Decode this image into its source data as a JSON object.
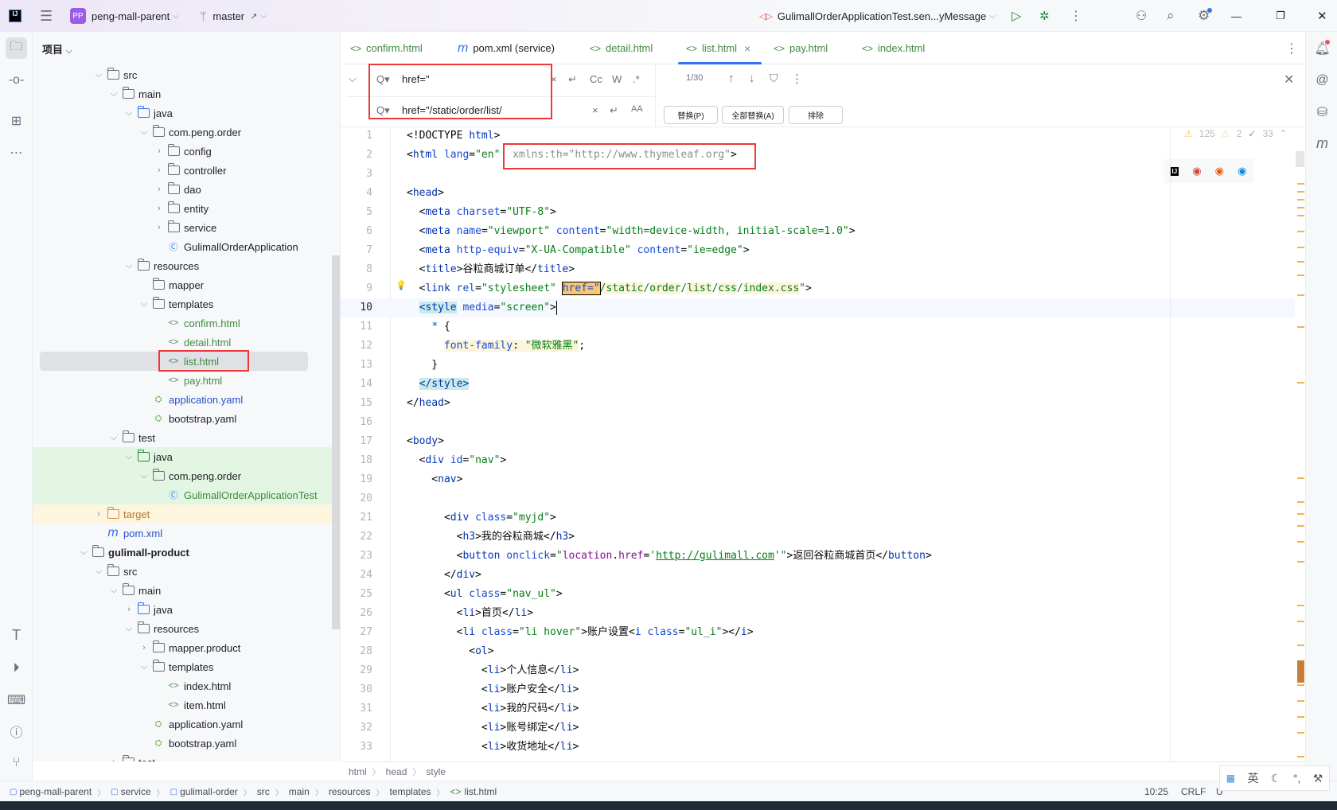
{
  "titlebar": {
    "project_badge": "PP",
    "project": "peng-mall-parent",
    "branch": "master",
    "run_config": "GulimallOrderApplicationTest.sen...yMessage"
  },
  "project_panel": {
    "title": "项目",
    "rows": [
      {
        "label": "src",
        "level": 2,
        "chev": "open",
        "icon": "folder"
      },
      {
        "label": "main",
        "level": 3,
        "chev": "open",
        "icon": "folder"
      },
      {
        "label": "java",
        "level": 4,
        "chev": "open",
        "icon": "folder-blue"
      },
      {
        "label": "com.peng.order",
        "level": 5,
        "chev": "open",
        "icon": "package"
      },
      {
        "label": "config",
        "level": 6,
        "chev": "closed",
        "icon": "package"
      },
      {
        "label": "controller",
        "level": 6,
        "chev": "closed",
        "icon": "package"
      },
      {
        "label": "dao",
        "level": 6,
        "chev": "closed",
        "icon": "package"
      },
      {
        "label": "entity",
        "level": 6,
        "chev": "closed",
        "icon": "package"
      },
      {
        "label": "service",
        "level": 6,
        "chev": "closed",
        "icon": "package"
      },
      {
        "label": "GulimallOrderApplication",
        "level": 6,
        "chev": "none",
        "icon": "spring-class"
      },
      {
        "label": "resources",
        "level": 4,
        "chev": "open",
        "icon": "folder-resources"
      },
      {
        "label": "mapper",
        "level": 5,
        "chev": "none",
        "icon": "folder"
      },
      {
        "label": "templates",
        "level": 5,
        "chev": "open",
        "icon": "folder"
      },
      {
        "label": "confirm.html",
        "level": 6,
        "chev": "none",
        "icon": "html",
        "color": "#3f8a3f"
      },
      {
        "label": "detail.html",
        "level": 6,
        "chev": "none",
        "icon": "html",
        "color": "#3f8a3f"
      },
      {
        "label": "list.html",
        "level": 6,
        "chev": "none",
        "icon": "html",
        "color": "#3f8a3f",
        "selected": true
      },
      {
        "label": "pay.html",
        "level": 6,
        "chev": "none",
        "icon": "html",
        "color": "#3f8a3f"
      },
      {
        "label": "application.yaml",
        "level": 5,
        "chev": "none",
        "icon": "spring-yaml",
        "color": "#2850c8"
      },
      {
        "label": "bootstrap.yaml",
        "level": 5,
        "chev": "none",
        "icon": "spring-yaml"
      },
      {
        "label": "test",
        "level": 3,
        "chev": "open",
        "icon": "folder"
      },
      {
        "label": "java",
        "level": 4,
        "chev": "open",
        "icon": "folder-green",
        "bg": "#e3f6e3"
      },
      {
        "label": "com.peng.order",
        "level": 5,
        "chev": "open",
        "icon": "package",
        "bg": "#e3f6e3"
      },
      {
        "label": "GulimallOrderApplicationTest",
        "level": 6,
        "chev": "none",
        "icon": "test-class",
        "color": "#3f8a3f",
        "bg": "#e3f6e3"
      },
      {
        "label": "target",
        "level": 2,
        "chev": "closed",
        "icon": "folder-orange",
        "color": "#b07a2a",
        "bg": "#fdf5dd"
      },
      {
        "label": "pom.xml",
        "level": 2,
        "chev": "none",
        "icon": "maven",
        "color": "#2850c8"
      },
      {
        "label": "gulimall-product",
        "level": 1,
        "chev": "open",
        "icon": "module",
        "bold": true
      },
      {
        "label": "src",
        "level": 2,
        "chev": "open",
        "icon": "folder"
      },
      {
        "label": "main",
        "level": 3,
        "chev": "open",
        "icon": "folder"
      },
      {
        "label": "java",
        "level": 4,
        "chev": "closed",
        "icon": "folder-blue"
      },
      {
        "label": "resources",
        "level": 4,
        "chev": "open",
        "icon": "folder-resources"
      },
      {
        "label": "mapper.product",
        "level": 5,
        "chev": "closed",
        "icon": "folder"
      },
      {
        "label": "templates",
        "level": 5,
        "chev": "open",
        "icon": "folder"
      },
      {
        "label": "index.html",
        "level": 6,
        "chev": "none",
        "icon": "html"
      },
      {
        "label": "item.html",
        "level": 6,
        "chev": "none",
        "icon": "html"
      },
      {
        "label": "application.yaml",
        "level": 5,
        "chev": "none",
        "icon": "spring-yaml"
      },
      {
        "label": "bootstrap.yaml",
        "level": 5,
        "chev": "none",
        "icon": "spring-yaml"
      },
      {
        "label": "test",
        "level": 3,
        "chev": "closed",
        "icon": "folder"
      }
    ]
  },
  "tabs": [
    {
      "label": "confirm.html",
      "icon": "html"
    },
    {
      "label": "pom.xml (service)",
      "icon": "maven"
    },
    {
      "label": "detail.html",
      "icon": "html"
    },
    {
      "label": "list.html",
      "icon": "html",
      "active": true
    },
    {
      "label": "pay.html",
      "icon": "html"
    },
    {
      "label": "index.html",
      "icon": "html"
    }
  ],
  "find": {
    "search_value": "href=\"",
    "replace_value": "href=\"/static/order/list/",
    "match_count": "1/30",
    "case_label": "Cc",
    "word_label": "W",
    "regex_label": ".*",
    "preserve_case_label": "AA",
    "replace_btn": "替换(P)",
    "replace_all_btn": "全部替换(A)",
    "exclude_btn": "排除"
  },
  "inspections": {
    "warnings": "125",
    "weak_warnings": "2",
    "typos": "33"
  },
  "editor": {
    "current_line": 10,
    "lines": [
      [
        [
          "p",
          "<!DOCTYPE "
        ],
        [
          "t",
          "html"
        ],
        [
          "p",
          ">"
        ]
      ],
      [
        [
          "p",
          "<"
        ],
        [
          "t",
          "html"
        ],
        [
          "a",
          " lang"
        ],
        [
          "p",
          "="
        ],
        [
          "v",
          "\"en\""
        ],
        [
          "g",
          "  xmlns:th=\"http://www.thymeleaf.org\""
        ],
        [
          "p",
          ">"
        ]
      ],
      [],
      [
        [
          "p",
          "<"
        ],
        [
          "t",
          "head"
        ],
        [
          "p",
          ">"
        ]
      ],
      [
        [
          "p",
          "  <"
        ],
        [
          "t",
          "meta"
        ],
        [
          "a",
          " charset"
        ],
        [
          "p",
          "="
        ],
        [
          "v",
          "\"UTF-8\""
        ],
        [
          "p",
          ">"
        ]
      ],
      [
        [
          "p",
          "  <"
        ],
        [
          "t",
          "meta"
        ],
        [
          "a",
          " name"
        ],
        [
          "p",
          "="
        ],
        [
          "v",
          "\"viewport\""
        ],
        [
          "a",
          " content"
        ],
        [
          "p",
          "="
        ],
        [
          "v",
          "\"width=device-width, initial-scale=1.0\""
        ],
        [
          "p",
          ">"
        ]
      ],
      [
        [
          "p",
          "  <"
        ],
        [
          "t",
          "meta"
        ],
        [
          "a",
          " http-equiv"
        ],
        [
          "p",
          "="
        ],
        [
          "v",
          "\"X-UA-Compatible\""
        ],
        [
          "a",
          " content"
        ],
        [
          "p",
          "="
        ],
        [
          "v",
          "\"ie=edge\""
        ],
        [
          "p",
          ">"
        ]
      ],
      [
        [
          "p",
          "  <"
        ],
        [
          "t",
          "title"
        ],
        [
          "p",
          ">谷粒商城订单</"
        ],
        [
          "t",
          "title"
        ],
        [
          "p",
          ">"
        ]
      ],
      [
        [
          "p",
          "  <"
        ],
        [
          "t",
          "link"
        ],
        [
          "a",
          " rel"
        ],
        [
          "p",
          "="
        ],
        [
          "v",
          "\"stylesheet\""
        ],
        [
          "p",
          " "
        ],
        [
          "hit",
          "href=\""
        ],
        [
          "vy",
          "/static"
        ],
        [
          "v",
          "/"
        ],
        [
          "vy",
          "order"
        ],
        [
          "v",
          "/"
        ],
        [
          "vy",
          "list"
        ],
        [
          "v",
          "/"
        ],
        [
          "vy",
          "css"
        ],
        [
          "v",
          "/"
        ],
        [
          "vy",
          "index.css"
        ],
        [
          "v",
          "\""
        ],
        [
          "p",
          ">"
        ]
      ],
      [
        [
          "p",
          "  "
        ],
        [
          "ts",
          "<style"
        ],
        [
          "a",
          " media"
        ],
        [
          "p",
          "="
        ],
        [
          "v",
          "\"screen\""
        ],
        [
          "p",
          ">"
        ]
      ],
      [
        [
          "p",
          "    "
        ],
        [
          "a",
          "*"
        ],
        [
          "p",
          " {"
        ]
      ],
      [
        [
          "p",
          "      "
        ],
        [
          "af",
          "font-family"
        ],
        [
          "pf",
          ": "
        ],
        [
          "vf",
          "\"微软雅黑\""
        ],
        [
          "p",
          ";"
        ]
      ],
      [
        [
          "p",
          "    }"
        ]
      ],
      [
        [
          "p",
          "  "
        ],
        [
          "ts",
          "</style>"
        ]
      ],
      [
        [
          "p",
          "</"
        ],
        [
          "t",
          "head"
        ],
        [
          "p",
          ">"
        ]
      ],
      [],
      [
        [
          "p",
          "<"
        ],
        [
          "t",
          "body"
        ],
        [
          "p",
          ">"
        ]
      ],
      [
        [
          "p",
          "  <"
        ],
        [
          "t",
          "div"
        ],
        [
          "a",
          " id"
        ],
        [
          "p",
          "="
        ],
        [
          "v",
          "\"nav\""
        ],
        [
          "p",
          ">"
        ]
      ],
      [
        [
          "p",
          "    <"
        ],
        [
          "t",
          "nav"
        ],
        [
          "p",
          ">"
        ]
      ],
      [],
      [
        [
          "p",
          "      <"
        ],
        [
          "t",
          "div"
        ],
        [
          "a",
          " class"
        ],
        [
          "p",
          "="
        ],
        [
          "v",
          "\"myjd\""
        ],
        [
          "p",
          ">"
        ]
      ],
      [
        [
          "p",
          "        <"
        ],
        [
          "t",
          "h3"
        ],
        [
          "p",
          ">我的谷粒商城</"
        ],
        [
          "t",
          "h3"
        ],
        [
          "p",
          ">"
        ]
      ],
      [
        [
          "p",
          "        <"
        ],
        [
          "t",
          "button"
        ],
        [
          "a",
          " onclick"
        ],
        [
          "p",
          "="
        ],
        [
          "v",
          "\""
        ],
        [
          "tj",
          "location"
        ],
        [
          "p",
          "."
        ],
        [
          "tj",
          "href"
        ],
        [
          "p",
          "="
        ],
        [
          "v",
          "'"
        ],
        [
          "vu",
          "http://gulimall.com"
        ],
        [
          "v",
          "'\""
        ],
        [
          "p",
          ">返回谷粒商城首页</"
        ],
        [
          "t",
          "button"
        ],
        [
          "p",
          ">"
        ]
      ],
      [
        [
          "p",
          "      </"
        ],
        [
          "t",
          "div"
        ],
        [
          "p",
          ">"
        ]
      ],
      [
        [
          "p",
          "      <"
        ],
        [
          "t",
          "ul"
        ],
        [
          "a",
          " class"
        ],
        [
          "p",
          "="
        ],
        [
          "v",
          "\"nav_ul\""
        ],
        [
          "p",
          ">"
        ]
      ],
      [
        [
          "p",
          "        <"
        ],
        [
          "t",
          "li"
        ],
        [
          "p",
          ">首页</"
        ],
        [
          "t",
          "li"
        ],
        [
          "p",
          ">"
        ]
      ],
      [
        [
          "p",
          "        <"
        ],
        [
          "t",
          "li"
        ],
        [
          "a",
          " class"
        ],
        [
          "p",
          "="
        ],
        [
          "v",
          "\"li hover\""
        ],
        [
          "p",
          ">账户设置<"
        ],
        [
          "t",
          "i"
        ],
        [
          "a",
          " class"
        ],
        [
          "p",
          "="
        ],
        [
          "v",
          "\"ul_i\""
        ],
        [
          "p",
          "></"
        ],
        [
          "t",
          "i"
        ],
        [
          "p",
          ">"
        ]
      ],
      [
        [
          "p",
          "          <"
        ],
        [
          "t",
          "ol"
        ],
        [
          "p",
          ">"
        ]
      ],
      [
        [
          "p",
          "            <"
        ],
        [
          "t",
          "li"
        ],
        [
          "p",
          ">个人信息</"
        ],
        [
          "t",
          "li"
        ],
        [
          "p",
          ">"
        ]
      ],
      [
        [
          "p",
          "            <"
        ],
        [
          "t",
          "li"
        ],
        [
          "p",
          ">账户安全</"
        ],
        [
          "t",
          "li"
        ],
        [
          "p",
          ">"
        ]
      ],
      [
        [
          "p",
          "            <"
        ],
        [
          "t",
          "li"
        ],
        [
          "p",
          ">我的尺码</"
        ],
        [
          "t",
          "li"
        ],
        [
          "p",
          ">"
        ]
      ],
      [
        [
          "p",
          "            <"
        ],
        [
          "t",
          "li"
        ],
        [
          "p",
          ">账号绑定</"
        ],
        [
          "t",
          "li"
        ],
        [
          "p",
          ">"
        ]
      ],
      [
        [
          "p",
          "            <"
        ],
        [
          "t",
          "li"
        ],
        [
          "p",
          ">收货地址</"
        ],
        [
          "t",
          "li"
        ],
        [
          "p",
          ">"
        ]
      ]
    ]
  },
  "breadcrumbs": [
    "html",
    "head",
    "style"
  ],
  "status": {
    "path": [
      "peng-mall-parent",
      "service",
      "gulimall-order",
      "src",
      "main",
      "resources",
      "templates",
      "list.html"
    ],
    "position": "10:25",
    "line_ending": "CRLF",
    "encoding_partial": "U"
  },
  "ime": {
    "lang": "英"
  },
  "colors": {
    "accent": "#3574f0",
    "highlight_box": "#f03838",
    "search_hit": "#f7c873"
  }
}
